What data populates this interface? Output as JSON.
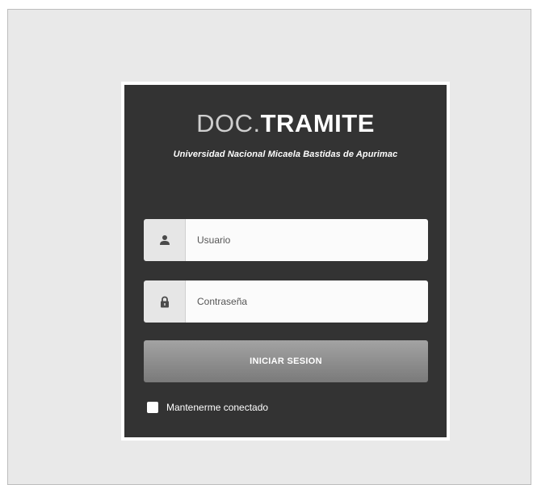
{
  "brand": {
    "title_light": "DOC.",
    "title_bold": "TRAMITE",
    "subtitle": "Universidad Nacional Micaela Bastidas de Apurimac"
  },
  "form": {
    "username_placeholder": "Usuario",
    "password_placeholder": "Contraseña",
    "submit_label": "INICIAR SESION",
    "remember_label": "Mantenerme conectado",
    "remember_checked": false
  },
  "icons": {
    "username": "user-icon",
    "password": "lock-icon"
  },
  "colors": {
    "page_background": "#e9e9e9",
    "card_background": "#333333",
    "button_gradient_top": "#a3a3a3",
    "button_gradient_bottom": "#7a7a7a",
    "input_addon_background": "#e6e6e6"
  }
}
